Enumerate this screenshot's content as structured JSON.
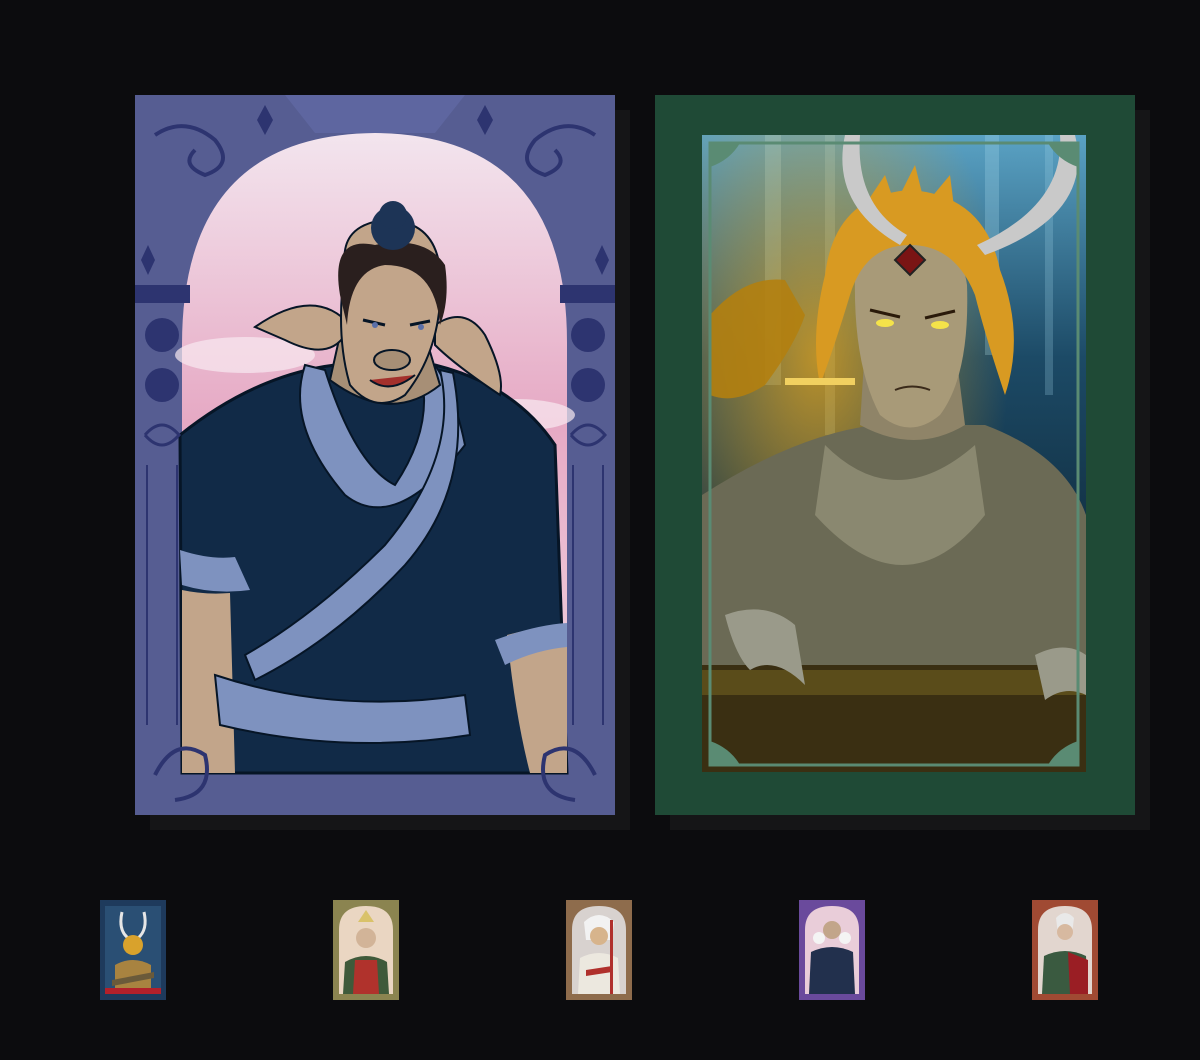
{
  "gallery": {
    "featured": [
      {
        "id": "card-pig",
        "frame_color": "#565d92",
        "frame_dark": "#2d3470",
        "sky_top": "#f3e5ee",
        "sky_bottom": "#e7a9c2",
        "icon": "pig-warrior-portrait"
      },
      {
        "id": "card-dragon",
        "frame_color": "#1f4a36",
        "frame_dark": "#5a8b73",
        "bg_top": "#7fb4c9",
        "bg_bottom": "#0b1a24",
        "icon": "dragon-horned-portrait"
      }
    ],
    "thumbnails": [
      {
        "frame_color": "#1e3a5c",
        "icon": "horned-warrior-thumbnail"
      },
      {
        "frame_color": "#8b8450",
        "icon": "crowned-monk-thumbnail"
      },
      {
        "frame_color": "#8e6c4c",
        "icon": "white-haired-staff-thumbnail"
      },
      {
        "frame_color": "#6a4a9c",
        "icon": "dark-robed-figure-thumbnail"
      },
      {
        "frame_color": "#a04a33",
        "icon": "red-robed-figure-thumbnail"
      }
    ]
  }
}
